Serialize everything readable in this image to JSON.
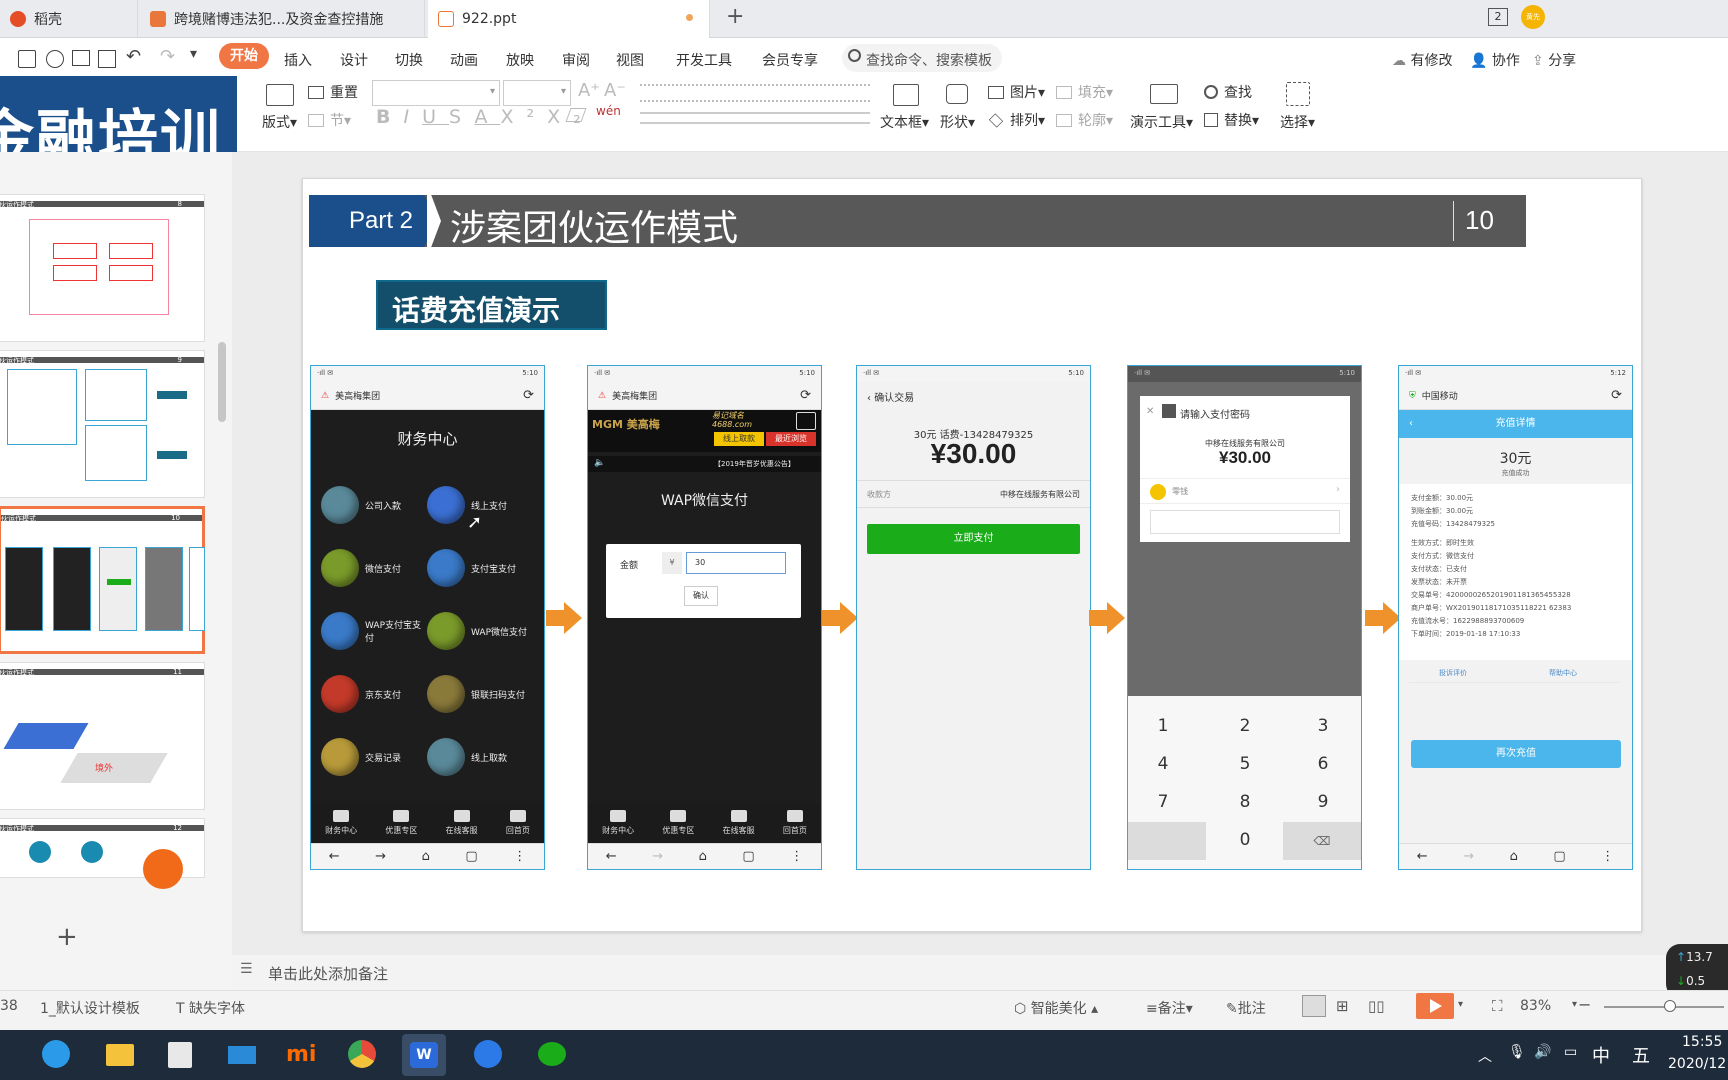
{
  "tabs": [
    {
      "label": "稻壳"
    },
    {
      "label": "跨境赌博违法犯...及资金查控措施"
    },
    {
      "label": "922.ppt"
    }
  ],
  "tab_counter": "2",
  "avatar_text": "黄先",
  "menu": {
    "items": [
      "开始",
      "插入",
      "设计",
      "切换",
      "动画",
      "放映",
      "审阅",
      "视图",
      "开发工具",
      "会员专享"
    ],
    "search_placeholder": "查找命令、搜索模板",
    "right": [
      "有修改",
      "协作",
      "分享"
    ]
  },
  "ribbon": {
    "reset": "重置",
    "layout": "版式",
    "section": "节",
    "textbox": "文本框",
    "shape": "形状",
    "picture": "图片",
    "arrange": "排列",
    "fill": "填充",
    "outline": "轮廓",
    "present_tool": "演示工具",
    "find": "查找",
    "replace": "替换",
    "select": "选择"
  },
  "banner": {
    "text": "金融培训"
  },
  "thumbnails": [
    {
      "title": "伙运作模式",
      "num": "8"
    },
    {
      "title": "伙运作模式",
      "num": "9"
    },
    {
      "title": "伙运作模式",
      "num": "10"
    },
    {
      "title": "伙运作模式",
      "num": "11"
    },
    {
      "title": "伙运作模式",
      "num": "12"
    }
  ],
  "slide": {
    "part": "Part 2",
    "title": "涉案团伙运作模式",
    "page_num": "10",
    "subtitle": "话费充值演示"
  },
  "phone1": {
    "status_time": "5:10",
    "url": "美高梅集团",
    "heading": "财务中心",
    "buttons": [
      "公司入款",
      "线上支付",
      "微信支付",
      "支付宝支付",
      "WAP支付宝支付",
      "WAP微信支付",
      "京东支付",
      "银联扫码支付",
      "交易记录",
      "线上取款"
    ],
    "nav": [
      "财务中心",
      "优惠专区",
      "在线客服",
      "回首页"
    ]
  },
  "phone2": {
    "status_time": "5:10",
    "url": "美高梅集团",
    "logo": "MGM 美高梅",
    "domain_line1": "易记域名",
    "domain_line2": "4688.com",
    "btn_withdraw": "线上取款",
    "btn_recent": "最近浏览",
    "notice": "【2019年晋岁优惠公告】",
    "heading": "WAP微信支付",
    "amount_label": "金额",
    "currency": "¥",
    "amount_value": "30",
    "confirm": "确认",
    "nav": [
      "财务中心",
      "优惠专区",
      "在线客服",
      "回首页"
    ]
  },
  "phone3": {
    "status_time": "5:10",
    "header": "确认交易",
    "desc": "30元 话费-13428479325",
    "amount": "¥30.00",
    "payee_label": "收款方",
    "payee": "中移在线服务有限公司",
    "pay_button": "立即支付"
  },
  "phone4": {
    "status_time": "5:10",
    "dialog_title": "请输入支付密码",
    "company": "中移在线服务有限公司",
    "amount": "¥30.00",
    "method": "零钱",
    "keys": [
      "1",
      "2",
      "3",
      "4",
      "5",
      "6",
      "7",
      "8",
      "9",
      "0"
    ]
  },
  "phone5": {
    "status_time": "5:12",
    "url": "中国移动",
    "header": "充值详情",
    "amount": "30元",
    "status": "充值成功",
    "details": [
      "支付金额：30.00元",
      "到账金额：30.00元",
      "充值号码：13428479325",
      "生效方式：即时生效",
      "支付方式：微信支付",
      "支付状态：已支付",
      "发票状态：未开票",
      "交易单号：4200000265201901181365455328",
      "商户单号：WX20190118171035118221 62383",
      "充值流水号：1622988893700609",
      "下单时间：2019-01-18 17:10:33"
    ],
    "link1": "投诉评价",
    "link2": "帮助中心",
    "recharge": "再次充值"
  },
  "notes_placeholder": "单击此处添加备注",
  "statusbar": {
    "page": "38",
    "template": "1_默认设计模板",
    "missing_font": "缺失字体",
    "beautify": "智能美化",
    "notes": "备注",
    "comment": "批注",
    "zoom": "83%"
  },
  "net": {
    "up": "13.7",
    "down": "0.5"
  },
  "clock": {
    "time": "15:55",
    "date": "2020/12"
  },
  "ime": {
    "lang": "中",
    "mode": "五"
  },
  "colors": {
    "accent": "#f07644",
    "slide_blue": "#1a4f8b",
    "subtitle_bg": "#134f6b",
    "wechat_green": "#1aad19"
  }
}
